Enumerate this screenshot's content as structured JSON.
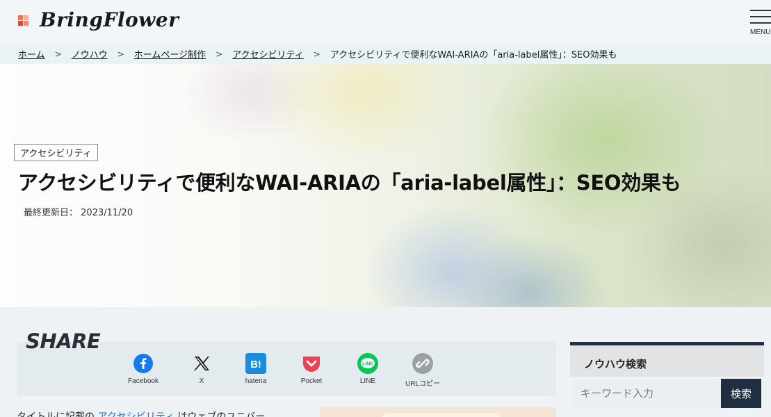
{
  "site": {
    "logo_text": "BringFlower",
    "logo_colors": [
      "#e9705a",
      "#f3b19d",
      "#d94b3a",
      "#f08b6e"
    ]
  },
  "header": {
    "menu_label": "MENU"
  },
  "breadcrumb": {
    "items": [
      {
        "label": "ホーム"
      },
      {
        "label": "ノウハウ"
      },
      {
        "label": "ホームページ制作"
      },
      {
        "label": "アクセシビリティ"
      }
    ],
    "separator": ">",
    "current": "アクセシビリティで便利なWAI-ARIAの「aria-label属性」：SEO効果も"
  },
  "article": {
    "category": "アクセシビリティ",
    "title": "アクセシビリティで便利なWAI-ARIAの「aria-label属性」：SEO効果も",
    "updated_label": "最終更新日：",
    "updated_date": "2023/11/20"
  },
  "share": {
    "title": "SHARE",
    "items": [
      {
        "label": "Facebook",
        "icon": "facebook-icon",
        "color": "#1877f2"
      },
      {
        "label": "X",
        "icon": "x-icon",
        "color": "#111111"
      },
      {
        "label": "hatena",
        "icon": "hatena-icon",
        "color": "#1a8ce0"
      },
      {
        "label": "Pocket",
        "icon": "pocket-icon",
        "color": "#ef4056"
      },
      {
        "label": "LINE",
        "icon": "line-icon",
        "color": "#06c755"
      },
      {
        "label": "URLコピー",
        "icon": "link-icon",
        "color": "#9aa0a6"
      }
    ]
  },
  "body": {
    "intro_before": "タイトルに記載の",
    "intro_link": "アクセシビリティ",
    "intro_after": "はウェブのユニバー"
  },
  "sidebar": {
    "search_title": "ノウハウ検索",
    "search_placeholder": "キーワード入力",
    "search_button": "検索"
  },
  "colors": {
    "accent": "#1f2e40",
    "link": "#1c6fd0"
  }
}
